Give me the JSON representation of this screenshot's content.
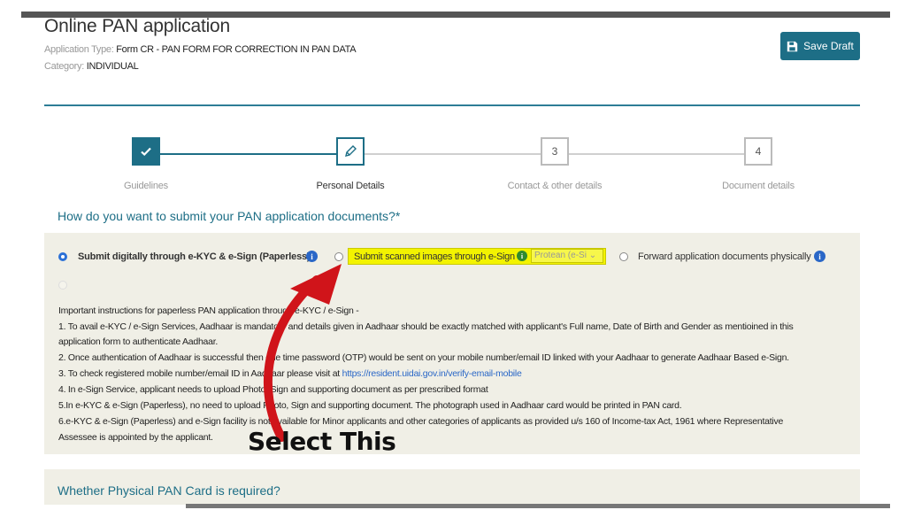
{
  "header": {
    "title": "Online PAN application",
    "application_type_label": "Application Type:",
    "application_type_value": "Form CR - PAN FORM FOR CORRECTION IN PAN DATA",
    "category_label": "Category:",
    "category_value": "INDIVIDUAL",
    "save_label": "Save Draft"
  },
  "steps": [
    {
      "label": "Guidelines",
      "mark": "",
      "state": "done"
    },
    {
      "label": "Personal Details",
      "mark": "",
      "state": "active"
    },
    {
      "label": "Contact & other details",
      "mark": "3",
      "state": "pending"
    },
    {
      "label": "Document details",
      "mark": "4",
      "state": "pending"
    }
  ],
  "question": "How do you want to submit your PAN application documents?*",
  "options": [
    {
      "label": "Submit digitally through e-KYC & e-Sign (Paperless)",
      "selected": true
    },
    {
      "label": "Submit scanned images through e-Sign",
      "selected": false,
      "select_value": "Protean (e-Si"
    },
    {
      "label": "Forward application documents physically",
      "selected": false
    }
  ],
  "instructions": {
    "heading": "Important instructions for paperless PAN application through e-KYC / e-Sign -",
    "l1a": "1. To avail e-KYC / e-Sign Services, Aadhaar is mandatory and details given in Aadhaar should be exactly matched with applicant's Full name, Date of Birth and Gender as mentioined in this",
    "l1b": "application form to authenticate Aadhaar.",
    "l2": "2. Once authentication of Aadhaar is successful then one time password (OTP) would be sent on your mobile number/email ID linked with your Aadhaar to generate Aadhaar Based e-Sign.",
    "l3": "3. To check registered mobile number/email ID in Aadhaar please visit at",
    "l3_link": "https://resident.uidai.gov.in/verify-email-mobile",
    "l4": "4. In e-Sign Service, applicant needs to upload Photo, Sign and supporting document as per prescribed format",
    "l5": "5.In e-KYC & e-Sign (Paperless), no need to upload Photo, Sign and supporting document. The photograph used in Aadhaar card would be printed in PAN card.",
    "l6a": "6.e-KYC & e-Sign (Paperless) and e-Sign facility is not available for Minor applicants and other categories of applicants as provided u/s 160 of Income-tax Act, 1961 where Representative",
    "l6b": "Assessee is appointed by the applicant."
  },
  "callout": "Select This",
  "physical_question": "Whether Physical PAN Card is required?",
  "colors": {
    "accent": "#1d6e86",
    "highlight": "#f3f300",
    "arrow": "#d0141a",
    "info": "#2a67c7"
  },
  "icons": {
    "save": "floppy-disk-icon",
    "step1": "check-icon",
    "step2": "pencil-icon",
    "info": "info-icon"
  }
}
